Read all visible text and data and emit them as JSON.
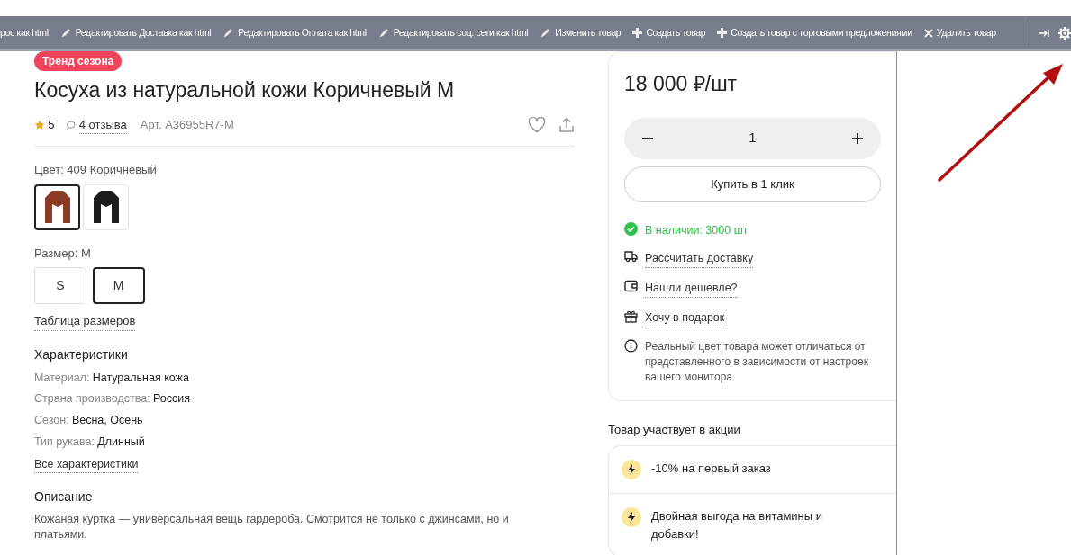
{
  "toolbar": {
    "items": [
      {
        "kind": "text",
        "label": "рос как html"
      },
      {
        "kind": "edit",
        "label": "Редактировать Доставка как html"
      },
      {
        "kind": "edit",
        "label": "Редактировать Оплата как html"
      },
      {
        "kind": "edit",
        "label": "Редактировать соц. сети как html"
      },
      {
        "kind": "edit",
        "label": "Изменить товар"
      },
      {
        "kind": "add",
        "label": "Создать товар"
      },
      {
        "kind": "add",
        "label": "Создать товар с торговыми предложениями"
      },
      {
        "kind": "delete",
        "label": "Удалить товар"
      }
    ]
  },
  "product": {
    "badge": "Тренд сезона",
    "title": "Косуха из натуральной кожи Коричневый M",
    "rating": "5",
    "reviews": "4 отзыва",
    "sku": "Арт. A36955R7-M"
  },
  "color_picker": {
    "label": "Цвет: 409 Коричневый",
    "swatches": [
      {
        "selected": true,
        "color": "#8e3b26"
      },
      {
        "selected": false,
        "color": "#1c1c1c"
      }
    ]
  },
  "size_picker": {
    "label": "Размер: M",
    "options": [
      {
        "label": "S",
        "selected": false
      },
      {
        "label": "M",
        "selected": true
      }
    ],
    "size_chart_link": "Таблица размеров"
  },
  "specs": {
    "title": "Характеристики",
    "rows": [
      {
        "name": "Материал:",
        "value": "Натуральная кожа"
      },
      {
        "name": "Страна производства:",
        "value": "Россия"
      },
      {
        "name": "Сезон:",
        "value": "Весна, Осень"
      },
      {
        "name": "Тип рукава:",
        "value": "Длинный"
      }
    ],
    "all_link": "Все характеристики"
  },
  "description": {
    "title": "Описание",
    "text": "Кожаная куртка — универсальная вещь гардероба. Смотрится не только с джинсами, но и платьями."
  },
  "buy_box": {
    "price": "18 000 ₽/шт",
    "quantity": "1",
    "buy_button": "Купить в 1 клик",
    "availability": "В наличии: 3000 шт",
    "links": [
      {
        "kind": "delivery",
        "label": "Рассчитать доставку"
      },
      {
        "kind": "cheaper",
        "label": "Нашли дешевле?"
      },
      {
        "kind": "gift",
        "label": "Хочу в подарок"
      }
    ],
    "note": "Реальный цвет товара может отличаться от представленного в зависимости от настроек вашего монитора"
  },
  "promotions": {
    "title": "Товар участвует в акции",
    "items": [
      {
        "text": "-10% на первый заказ"
      },
      {
        "text": "Двойная выгода на витамины и добавки!"
      }
    ]
  }
}
